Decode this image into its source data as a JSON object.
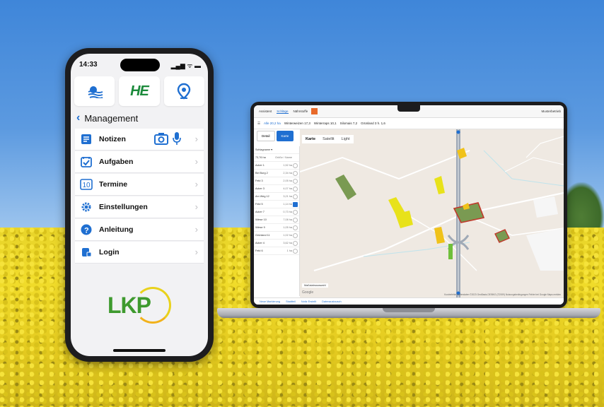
{
  "phone": {
    "status_time": "14:33",
    "status_icons": "▂▄▆ ᯤ ▬",
    "tiles": [
      {
        "name": "weather",
        "icon": "weather-icon"
      },
      {
        "name": "he",
        "text": "HE"
      },
      {
        "name": "location",
        "icon": "location-pin-icon"
      }
    ],
    "header": {
      "back": "‹",
      "title": "Management"
    },
    "menu": [
      {
        "label": "Notizen",
        "icon": "notes-icon"
      },
      {
        "label": "Aufgaben",
        "icon": "tasks-icon"
      },
      {
        "label": "Termine",
        "icon": "calendar-icon"
      },
      {
        "label": "Einstellungen",
        "icon": "settings-gear-icon"
      },
      {
        "label": "Anleitung",
        "icon": "help-icon"
      },
      {
        "label": "Login",
        "icon": "login-icon"
      }
    ],
    "chevron": "›",
    "logo": "LKP"
  },
  "laptop": {
    "nav": {
      "items": [
        "Assistent",
        "Schläge",
        "Nährstoffe"
      ],
      "active": 1,
      "right": "Musterbetrieb"
    },
    "crops": {
      "all": "Alle 20,2 ha",
      "items": [
        "Winterweizen 17,3",
        "Winterraps 10,1",
        "Silomais 7,2",
        "Grünland 3 h. 1,6"
      ]
    },
    "view_tabs": [
      "Detail",
      "Karte"
    ],
    "map_tabs": [
      "Karte",
      "Satellit",
      "Light"
    ],
    "sidelist": {
      "header": "Schlagname ▾",
      "total": "73,76 ha",
      "columns": "Größe / Name",
      "rows": [
        {
          "name": "Acker 1",
          "size": "1,52 ha",
          "checked": false
        },
        {
          "name": "Bei Burg 2",
          "size": "2,34 ha",
          "checked": false
        },
        {
          "name": "Feld 3",
          "size": "2,05 ha",
          "checked": false
        },
        {
          "name": "Acker 3",
          "size": "4,07 ha",
          "checked": false
        },
        {
          "name": "Am Weg 12",
          "size": "3,21 ha",
          "checked": false
        },
        {
          "name": "Feld 5",
          "size": "1,14 ha",
          "checked": true
        },
        {
          "name": "Acker 7",
          "size": "0,73 ha",
          "checked": false
        },
        {
          "name": "Wiese 10",
          "size": "7,08 ha",
          "checked": false
        },
        {
          "name": "Wiese 9",
          "size": "1,05 ha",
          "checked": false
        },
        {
          "name": "Grünland 11",
          "size": "1,02 ha",
          "checked": false
        },
        {
          "name": "Acker 4",
          "size": "3,62 ha",
          "checked": false
        },
        {
          "name": "Feld 6",
          "size": "1 ha",
          "checked": false
        }
      ]
    },
    "scale_label": "Maßstabsauswahl",
    "google": "Google",
    "attribution": "Kurzbefehle   Kartendaten ©2023 GeoBasis-DE/BKG (©2009)   Nutzungsbedingungen   Fehler bei Google Maps melden",
    "bottom": [
      "Neue Markierung",
      "Stadtteil",
      "Notiz Erstellt",
      "Datenaustausch"
    ]
  },
  "colors": {
    "accent": "#1f6fd1",
    "brand_green": "#1b8a3b",
    "field_dark_green": "#7a9a52",
    "field_yellow": "#e8e21a",
    "field_green": "#6fbf3a",
    "field_orange": "#f0c21a",
    "field_red_outline": "#c0392b"
  }
}
